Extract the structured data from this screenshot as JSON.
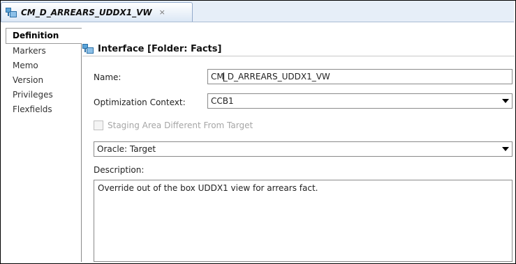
{
  "tab": {
    "title": "CM_D_ARREARS_UDDX1_VW",
    "close": "×"
  },
  "sidebar": {
    "items": [
      {
        "label": "Definition",
        "active": true
      },
      {
        "label": "Markers"
      },
      {
        "label": "Memo"
      },
      {
        "label": "Version"
      },
      {
        "label": "Privileges"
      },
      {
        "label": "Flexfields"
      }
    ]
  },
  "header": {
    "title": "Interface [Folder: Facts]"
  },
  "form": {
    "name_label": "Name:",
    "name_value_pre": "CM",
    "name_value_post": "_D_ARREARS_UDDX1_VW",
    "opt_context_label": "Optimization Context:",
    "opt_context_value": "CCB1",
    "staging_label": "Staging Area Different From Target",
    "staging_checked": false,
    "target_value": "Oracle: Target",
    "description_label": "Description:",
    "description_value": "Override out of the box UDDX1 view for arrears fact."
  }
}
